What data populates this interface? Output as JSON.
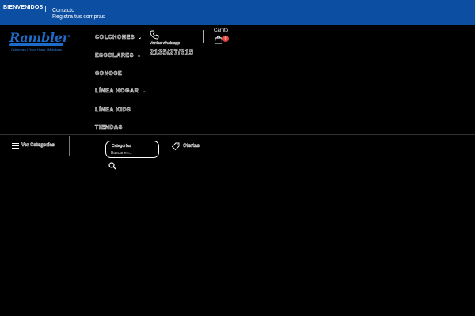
{
  "topbar": {
    "welcome": "BIENVENIDOS",
    "links": [
      "Contacto",
      "Registra tus compras"
    ]
  },
  "logo": {
    "brand": "Rambler",
    "tagline": "Colchones | Ropa Hogar | Mobiliario",
    "color": "#1e6cc9"
  },
  "nav": {
    "items": [
      {
        "label": "COLCHONES",
        "has_dropdown": true
      },
      {
        "label": "ESCOLARES",
        "has_dropdown": true
      },
      {
        "label": "CONOCE",
        "has_dropdown": false
      },
      {
        "label": "LÍNEA HOGAR",
        "has_dropdown": true
      },
      {
        "label": "LÍNEA KIDS",
        "has_dropdown": false
      },
      {
        "label": "TIENDAS",
        "has_dropdown": false
      }
    ]
  },
  "contact": {
    "icon": "phone-icon",
    "label": "Ventas whatsapp",
    "number": "2135/27/315"
  },
  "cart": {
    "label": "Carrito",
    "icon": "shopping-bag-icon",
    "count": "0",
    "badge_color": "#e0453c"
  },
  "categories_button": {
    "label": "Ver Categorías",
    "icon": "menu-icon"
  },
  "search": {
    "category_label": "Categorías",
    "placeholder": "Buscar en...",
    "icon": "search-icon"
  },
  "offers": {
    "label": "Ofertas",
    "icon": "tag-icon"
  },
  "colors": {
    "topbar_bg": "#0b4ea2",
    "page_bg": "#000000"
  }
}
